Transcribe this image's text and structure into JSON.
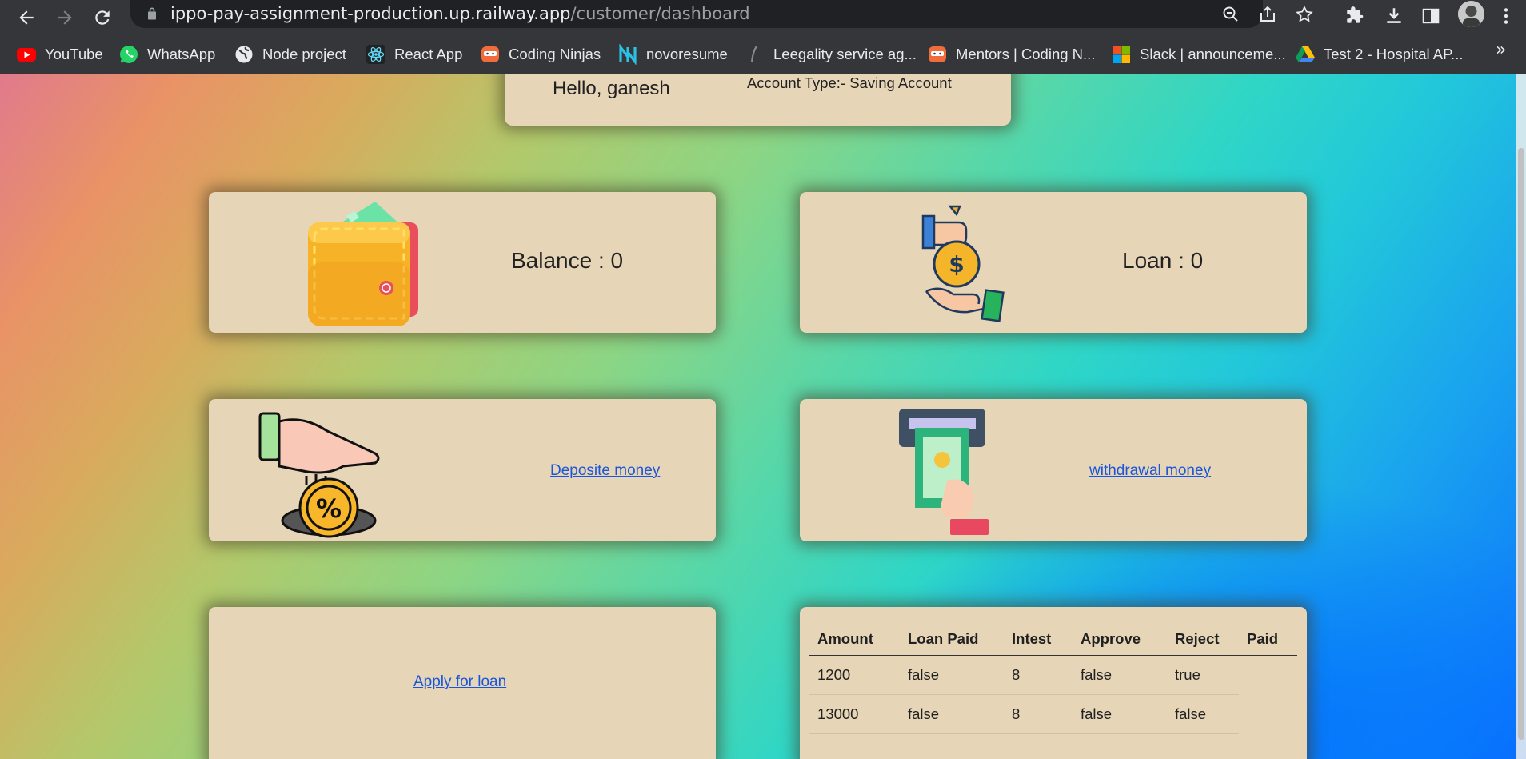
{
  "browser": {
    "url_host": "ippo-pay-assignment-production.up.railway.app",
    "url_path": "/customer/dashboard",
    "bookmarks": [
      {
        "label": "YouTube",
        "icon": "youtube-icon"
      },
      {
        "label": "WhatsApp",
        "icon": "whatsapp-icon"
      },
      {
        "label": "Node project",
        "icon": "globe-icon"
      },
      {
        "label": "React App",
        "icon": "react-icon"
      },
      {
        "label": "Coding Ninjas",
        "icon": "coding-ninjas-icon"
      },
      {
        "label": "novoresume",
        "icon": "novoresume-icon"
      },
      {
        "label": "Leegality service ag...",
        "icon": "leegality-icon"
      },
      {
        "label": "Mentors | Coding N...",
        "icon": "coding-ninjas-icon"
      },
      {
        "label": "Slack | announceme...",
        "icon": "microsoft-icon"
      },
      {
        "label": "Test 2 - Hospital AP...",
        "icon": "google-drive-icon"
      }
    ],
    "overflow_label": "»"
  },
  "header": {
    "greeting": "Hello, ganesh",
    "account_type": "Account Type:- Saving Account"
  },
  "cards": {
    "balance_text": "Balance : 0",
    "loan_text": "Loan : 0",
    "deposit_link": "Deposite money",
    "withdraw_link": "withdrawal money",
    "apply_link": "Apply for loan"
  },
  "loans_table": {
    "columns": [
      "Amount",
      "Loan Paid",
      "Intest",
      "Approve",
      "Reject",
      "Paid"
    ],
    "rows": [
      [
        "1200",
        "false",
        "8",
        "false",
        "true",
        ""
      ],
      [
        "13000",
        "false",
        "8",
        "false",
        "false",
        ""
      ]
    ]
  },
  "colors": {
    "card_bg": "#e7d5b7",
    "link": "#1a56db",
    "chrome_bg": "#35363a",
    "omnibox_bg": "#202124"
  }
}
